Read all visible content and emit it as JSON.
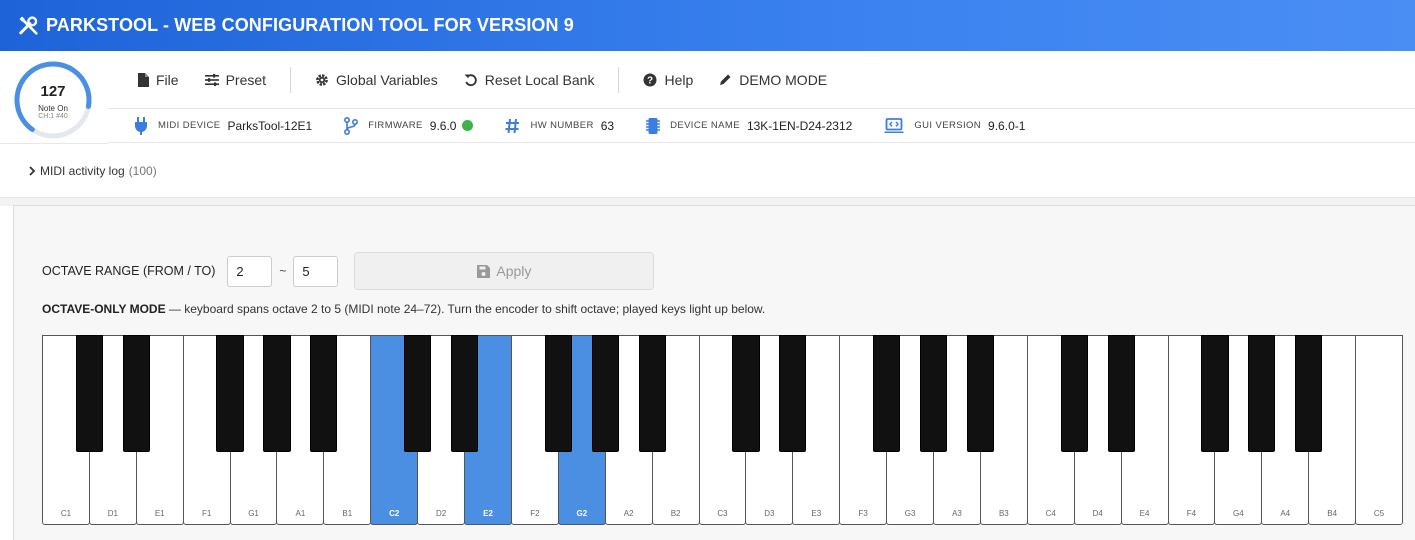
{
  "app": {
    "title": "PARKSTOOL - WEB CONFIGURATION TOOL FOR VERSION 9",
    "title_icon": "tools-icon"
  },
  "gauge": {
    "value": "127",
    "label": "Note On",
    "sub": "CH:1 #40",
    "level": 0.85,
    "color": "#4a8fe2"
  },
  "menu": {
    "items": [
      {
        "label": "File",
        "icon": "file-icon"
      },
      {
        "label": "Preset",
        "icon": "sliders-icon"
      },
      {
        "label": "Global Variables",
        "icon": "gear-icon"
      },
      {
        "label": "Reset Local Bank",
        "icon": "undo-icon"
      },
      {
        "label": "Help",
        "icon": "question-circle-icon"
      },
      {
        "label": "DEMO MODE",
        "icon": "pencil-icon"
      }
    ]
  },
  "info": {
    "midi_device": {
      "key": "MIDI DEVICE",
      "value": "ParksTool-12E1",
      "icon": "plug-icon"
    },
    "firmware": {
      "key": "FIRMWARE",
      "value": "9.6.0",
      "icon": "branch-icon",
      "status_color": "#3fb24a"
    },
    "hw_number": {
      "key": "HW NUMBER",
      "value": "63",
      "icon": "hash-icon"
    },
    "device_name": {
      "key": "DEVICE NAME",
      "value": "13K-1EN-D24-2312",
      "icon": "chip-icon"
    },
    "gui_version": {
      "key": "GUI VERSION",
      "value": "9.6.0-1",
      "icon": "laptop-code-icon"
    }
  },
  "log": {
    "label": "MIDI activity log",
    "count": "(100)"
  },
  "octave": {
    "label": "OCTAVE RANGE (FROM / TO)",
    "from": "2",
    "to": "5",
    "separator": "~",
    "apply_label": "Apply"
  },
  "mode": {
    "title": "OCTAVE-ONLY MODE",
    "description": " — keyboard spans octave 2 to 5 (MIDI note 24–72). Turn the encoder to shift octave; played keys light up below."
  },
  "keyboard": {
    "white_keys": [
      "C1",
      "D1",
      "E1",
      "F1",
      "G1",
      "A1",
      "B1",
      "C2",
      "D2",
      "E2",
      "F2",
      "G2",
      "A2",
      "B2",
      "C3",
      "D3",
      "E3",
      "F3",
      "G3",
      "A3",
      "B3",
      "C4",
      "D4",
      "E4",
      "F4",
      "G4",
      "A4",
      "B4",
      "C5"
    ],
    "lit_keys": [
      "C2",
      "E2",
      "G2"
    ],
    "lit_color": "#4a8fe2"
  }
}
